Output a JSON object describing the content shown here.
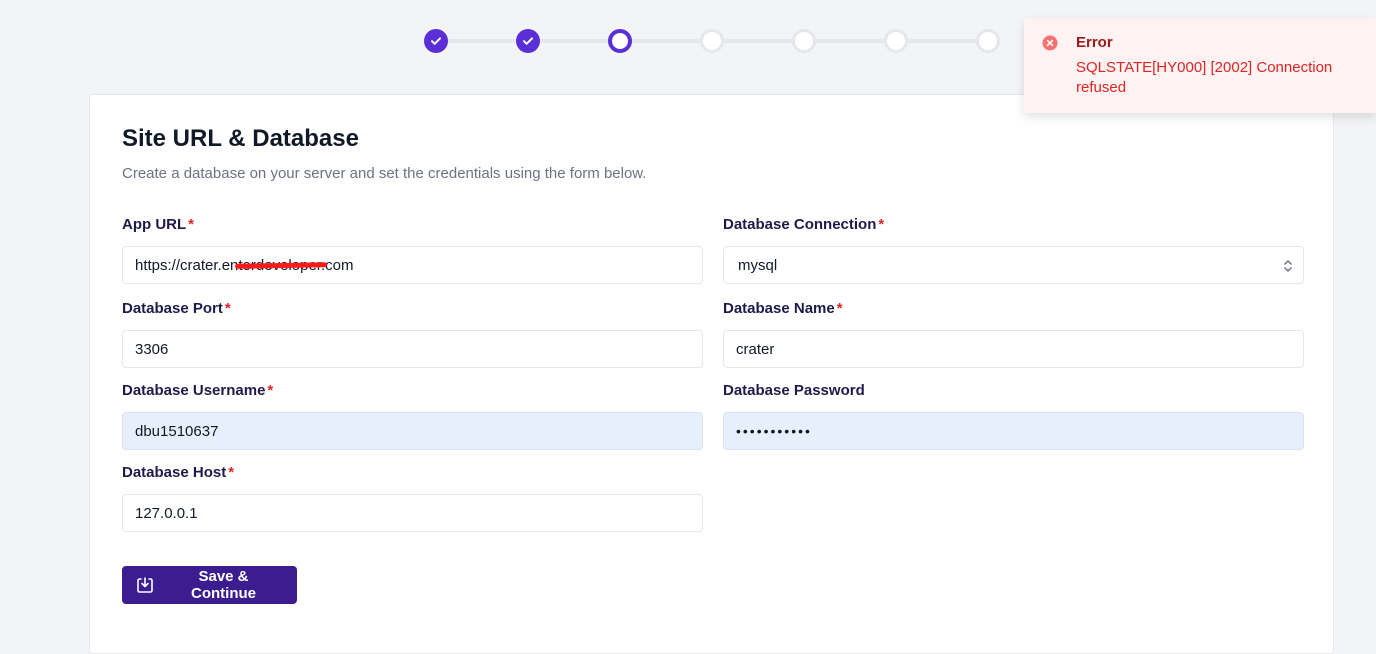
{
  "stepper": {
    "steps": [
      "done",
      "done",
      "current",
      "todo",
      "todo",
      "todo",
      "todo"
    ]
  },
  "page": {
    "title": "Site URL & Database",
    "subtitle": "Create a database on your server and set the credentials using the form below."
  },
  "form": {
    "app_url": {
      "label": "App URL",
      "required": "*",
      "value": "https://crater.enterdeveloper.com"
    },
    "db_connection": {
      "label": "Database Connection",
      "required": "*",
      "value": "mysql"
    },
    "db_port": {
      "label": "Database Port",
      "required": "*",
      "value": "3306"
    },
    "db_name": {
      "label": "Database Name",
      "required": "*",
      "value": "crater"
    },
    "db_username": {
      "label": "Database Username",
      "required": "*",
      "value": "dbu1510637"
    },
    "db_password": {
      "label": "Database Password",
      "value": "•••••••••••"
    },
    "db_host": {
      "label": "Database Host",
      "required": "*",
      "value": "127.0.0.1"
    },
    "save_label": "Save & Continue"
  },
  "toast": {
    "title": "Error",
    "message": "SQLSTATE[HY000] [2002] Connection refused",
    "icon": "x-circle-icon"
  },
  "colors": {
    "primary": "#5b2fd6",
    "button": "#3b1d8f",
    "error": "#dc2626"
  }
}
